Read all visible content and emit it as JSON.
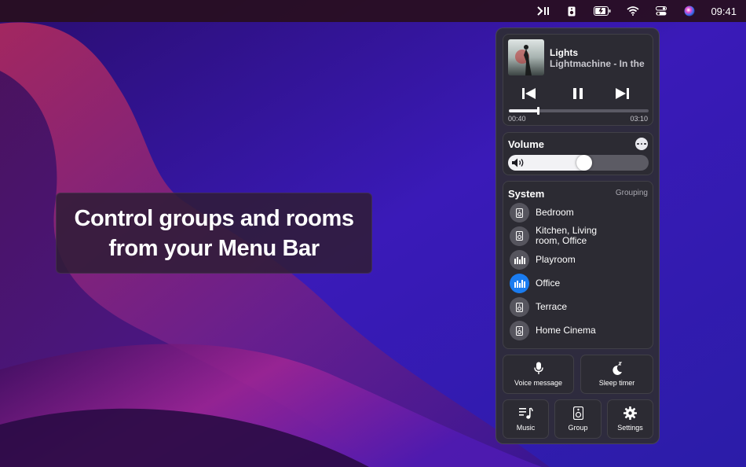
{
  "menubar": {
    "icons": [
      "play-pause-icon",
      "speaker-icon",
      "battery-icon",
      "wifi-icon",
      "control-center-icon",
      "siri-icon"
    ],
    "time": "09:41"
  },
  "caption": {
    "line1": "Control groups and rooms",
    "line2": "from your Menu Bar"
  },
  "now_playing": {
    "title": "Lights",
    "artist": "Lightmachine - In the Dark",
    "elapsed": "00:40",
    "duration": "03:10",
    "progress": 0.21,
    "controls": [
      "previous-icon",
      "pause-icon",
      "next-icon"
    ]
  },
  "volume": {
    "label": "Volume",
    "level": 0.54,
    "icon": "speaker-volume-icon",
    "more_icon": "ellipsis-icon"
  },
  "system": {
    "label": "System",
    "grouping_label": "Grouping",
    "rooms": [
      {
        "label": "Bedroom",
        "icon": "speaker-icon",
        "active": false
      },
      {
        "label": "Kitchen, Living room, Office",
        "icon": "speaker-icon",
        "active": false
      },
      {
        "label": "Playroom",
        "icon": "equalizer-icon",
        "active": false
      },
      {
        "label": "Office",
        "icon": "equalizer-icon",
        "active": true
      },
      {
        "label": "Terrace",
        "icon": "speaker-icon",
        "active": false
      },
      {
        "label": "Home Cinema",
        "icon": "speaker-icon",
        "active": false
      }
    ]
  },
  "actions": {
    "voice_message": "Voice message",
    "sleep_timer": "Sleep timer",
    "music": "Music",
    "group": "Group",
    "settings": "Settings"
  },
  "colors": {
    "accent": "#1a7cf0",
    "panel": "#2e2c3a",
    "card": "#2c2b33"
  }
}
